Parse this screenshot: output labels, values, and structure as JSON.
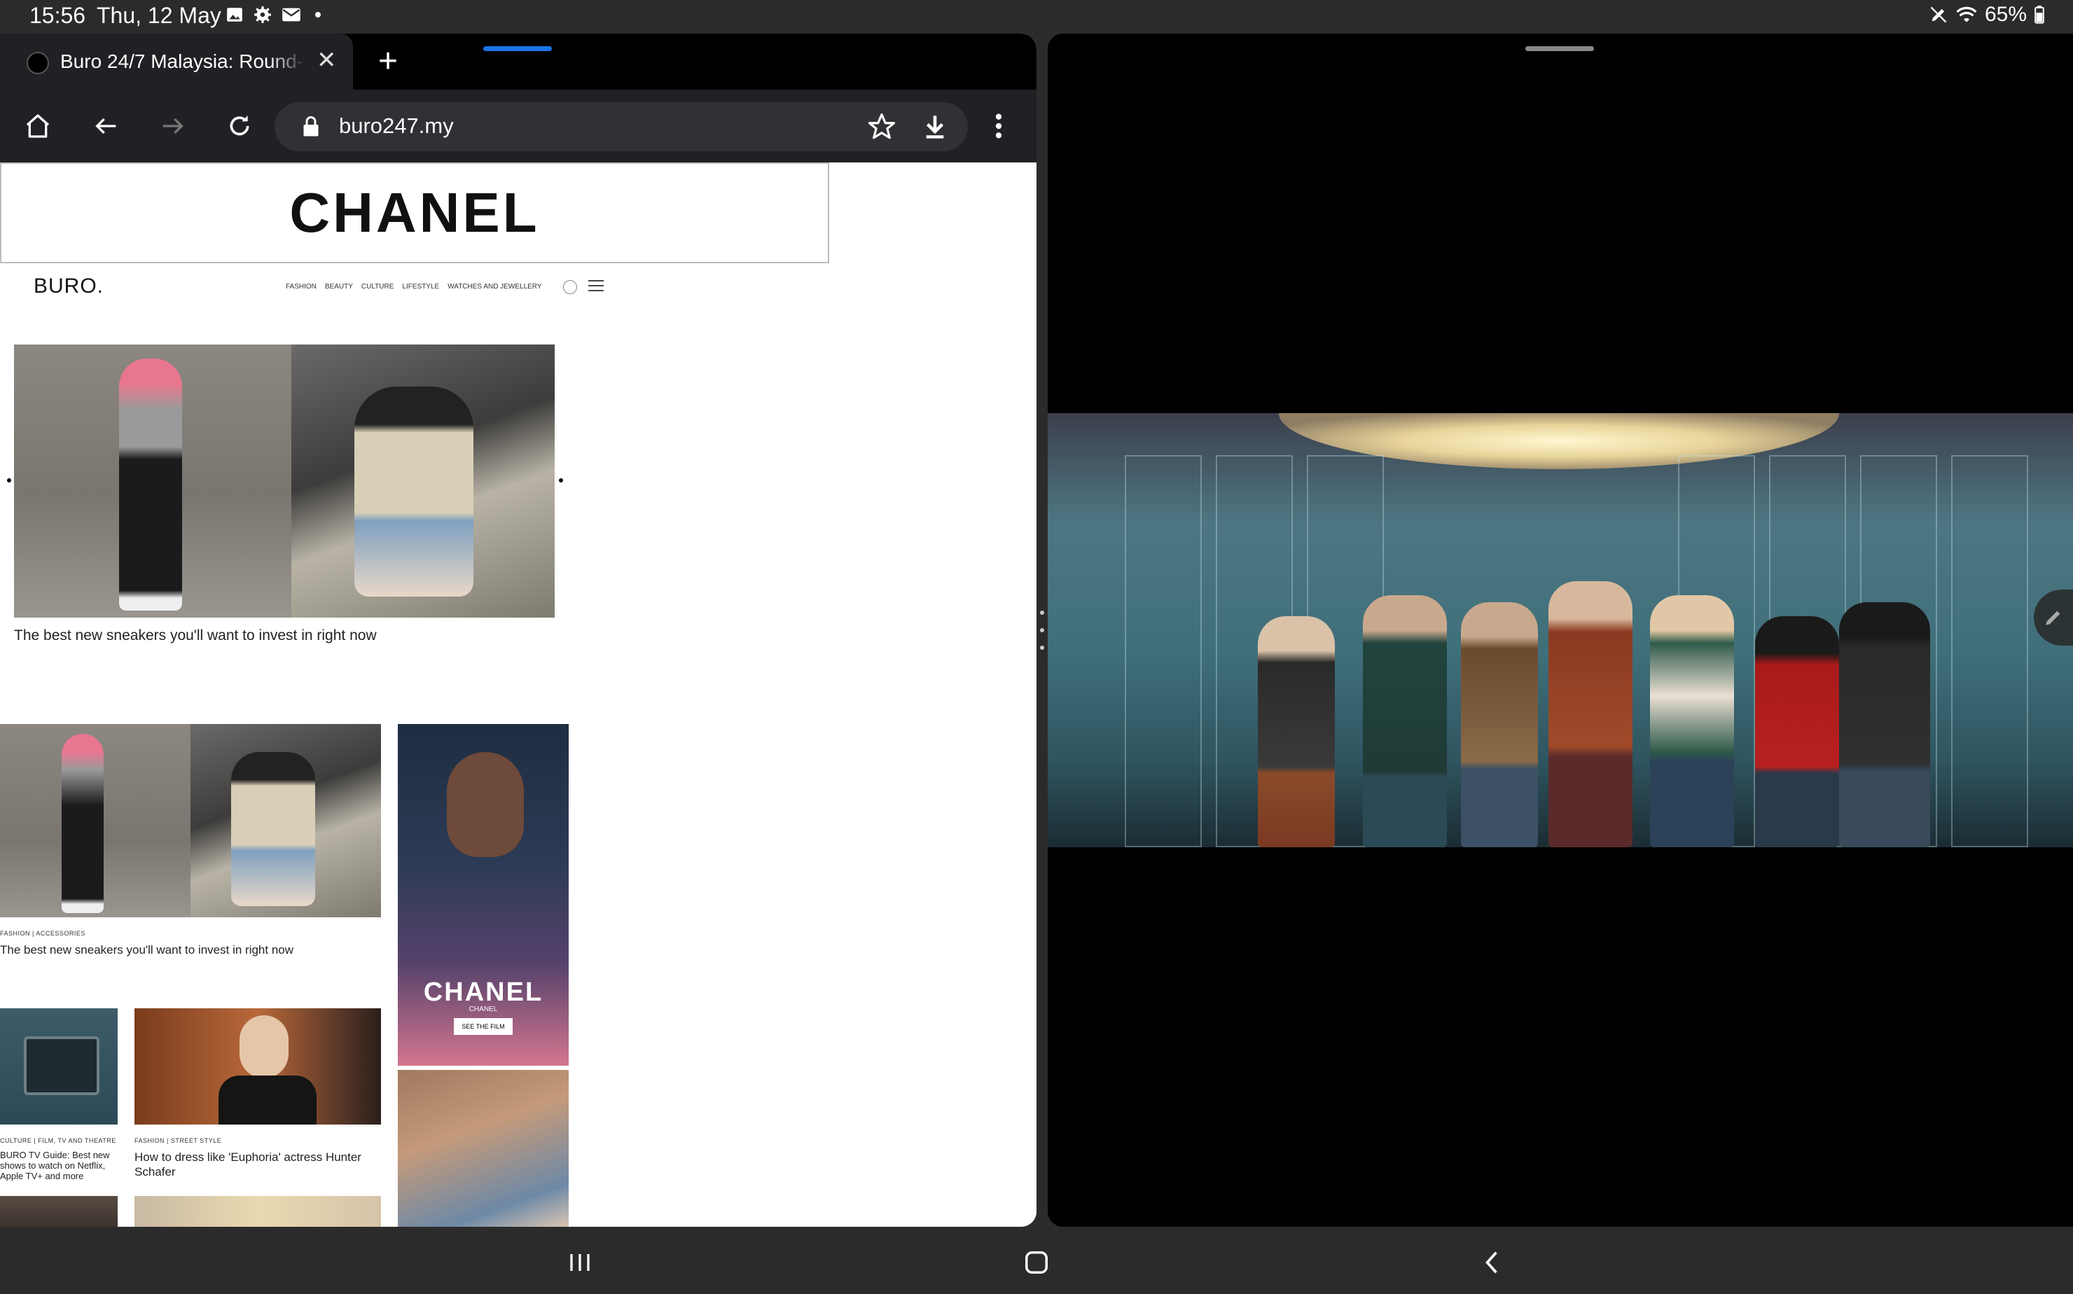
{
  "status_bar": {
    "time": "15:56",
    "date": "Thu, 12 May",
    "notification_icons": [
      "gallery-icon",
      "settings-icon",
      "email-icon",
      "more-dot-icon"
    ],
    "battery": "65%"
  },
  "browser": {
    "tab_title": "Buro 24/7 Malaysia: Round-t",
    "url": "buro247.my",
    "accent_color": "#1a73e8"
  },
  "page": {
    "banner_logo": "CHANEL",
    "site_logo": "BURO.",
    "nav_links": [
      "FASHION",
      "BEAUTY",
      "CULTURE",
      "LIFESTYLE",
      "WATCHES AND JEWELLERY"
    ],
    "hero_caption": "The best new sneakers you'll want to invest in right now",
    "cards": [
      {
        "category": "FASHION  |  ACCESSORIES",
        "title": "The best new sneakers you'll want to invest in right now"
      },
      {
        "category": "CULTURE  |  FILM, TV AND THEATRE",
        "title": "BURO TV Guide: Best new shows to watch on Netflix, Apple TV+ and more"
      },
      {
        "category": "FASHION  |  STREET STYLE",
        "title": "How to dress like 'Euphoria' actress Hunter Schafer"
      }
    ],
    "ad": {
      "logo": "CHANEL",
      "sub": "CHANEL",
      "cta": "SEE THE FILM"
    }
  }
}
